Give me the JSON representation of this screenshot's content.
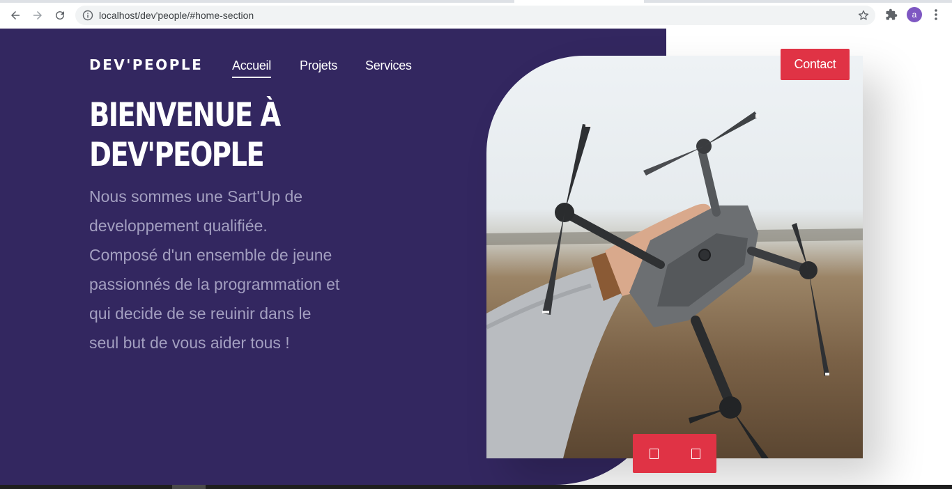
{
  "browser": {
    "url": "localhost/dev'people/#home-section",
    "profile_initial": "a",
    "icons": [
      "back-arrow-icon",
      "forward-arrow-icon",
      "reload-icon",
      "info-icon",
      "star-icon",
      "extensions-puzzle-icon",
      "kebab-menu-icon"
    ]
  },
  "site": {
    "logo": "DEV'PEOPLE",
    "nav": [
      {
        "label": "Accueil",
        "active": true
      },
      {
        "label": "Projets",
        "active": false
      },
      {
        "label": "Services",
        "active": false
      }
    ],
    "contact_label": "Contact"
  },
  "hero": {
    "headline_line1": "BIENVENUE À",
    "headline_line2": "DEV'PEOPLE",
    "intro": "Nous sommes une Sart'Up de developpement qualifiée. Composé d'un ensemble de jeune passionnés de la programmation et qui decide de se reuinir dans le seul but de vous aider tous !"
  },
  "slider": {
    "prev_icon": "square-glyph-icon",
    "next_icon": "square-glyph-icon"
  },
  "colors": {
    "hero_bg": "#332760",
    "accent": "#e03345",
    "intro_text": "#a39fc0"
  }
}
